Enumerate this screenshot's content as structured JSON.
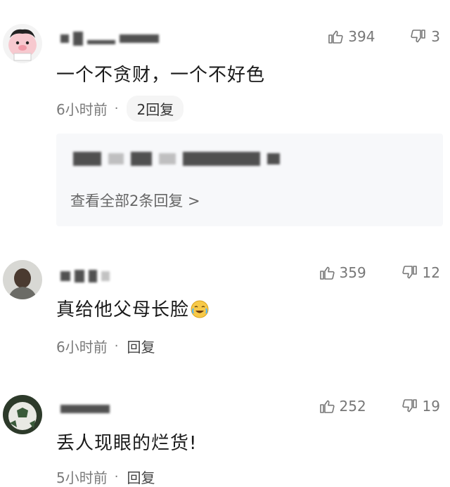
{
  "comments": [
    {
      "text": "一个不贪财，一个不好色",
      "time": "6小时前",
      "separator": "·",
      "reply_label": "2回复",
      "likes": "394",
      "dislikes": "3",
      "replies_preview": {
        "view_all": "查看全部2条回复 >"
      }
    },
    {
      "text": "真给他父母长脸",
      "emoji": "crying-laughing-emoji",
      "time": "6小时前",
      "separator": "·",
      "reply_label": "回复",
      "likes": "359",
      "dislikes": "12"
    },
    {
      "text": "丢人现眼的烂货!",
      "time": "5小时前",
      "separator": "·",
      "reply_label": "回复",
      "likes": "252",
      "dislikes": "19"
    }
  ],
  "icons": {
    "like": "thumbs-up-icon",
    "dislike": "thumbs-down-icon"
  },
  "colors": {
    "meta": "#7a7a7a",
    "reply_box_bg": "#f7f8fa",
    "text": "#1a1a1a"
  }
}
